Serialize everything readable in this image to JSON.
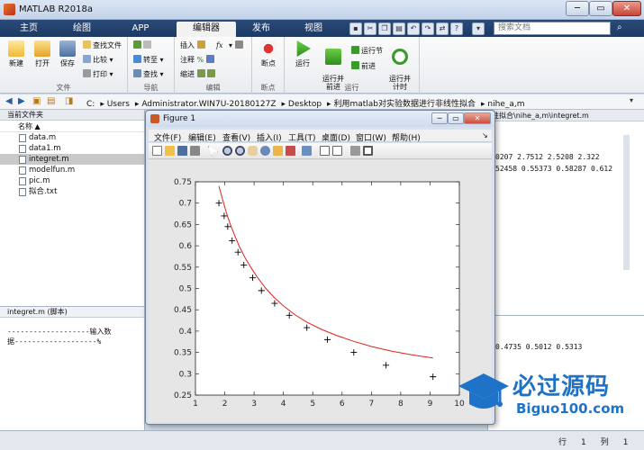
{
  "window": {
    "title": "MATLAB R2018a",
    "min": "─",
    "max": "▭",
    "close": "✕"
  },
  "ribbon_tabs": [
    "主页",
    "绘图",
    "APP",
    "编辑器",
    "发布",
    "视图"
  ],
  "search": {
    "placeholder": "搜索文档"
  },
  "ribbon": {
    "file": {
      "label": "文件",
      "new": "新建",
      "open": "打开",
      "save": "保存",
      "find_files": "查找文件",
      "compare": "比较",
      "print": "打印"
    },
    "navigate": {
      "label": "导航",
      "goto": "转至",
      "find": "查找"
    },
    "edit": {
      "label": "编辑",
      "insert": "插入",
      "comment": "注释",
      "indent": "缩进",
      "fx": "fx"
    },
    "breakpoints": {
      "label": "断点",
      "breakpoints": "断点"
    },
    "run": {
      "label": "运行",
      "run": "运行",
      "run_advance": "运行并\n前进",
      "run_section": "运行节",
      "advance": "前进",
      "run_time": "运行并\n计时"
    }
  },
  "address": {
    "segments": [
      "C:",
      "Users",
      "Administrator.WIN7U-20180127Z",
      "Desktop",
      "利用matlab对实验数据进行非线性拟合",
      "nihe_a,m"
    ]
  },
  "file_panel": {
    "header": "当前文件夹",
    "column": "名称 ▲",
    "files": [
      "data.m",
      "data1.m",
      "integret.m",
      "modelfun.m",
      "pic.m",
      "拟合.txt"
    ]
  },
  "detail_panel": {
    "header": "integret.m  (脚本)",
    "lines": [
      "-------------------输入数",
      "据-------------------%"
    ]
  },
  "editor": {
    "header": "性拟合\\nihe_a,m\\integret.m",
    "row1": "0207  2.7512  2.5208  2.322",
    "row2": "52458 0.55373 0.58287 0.612"
  },
  "command": {
    "row1": "0.4735    0.5012    0.5313"
  },
  "status": {
    "row_label": "行",
    "row_value": "1",
    "col_label": "列",
    "col_value": "1"
  },
  "figure": {
    "title": "Figure 1",
    "menus": [
      "文件(F)",
      "编辑(E)",
      "查看(V)",
      "插入(I)",
      "工具(T)",
      "桌面(D)",
      "窗口(W)",
      "帮助(H)"
    ]
  },
  "chart_data": {
    "type": "scatter",
    "title": "",
    "xlabel": "",
    "ylabel": "",
    "xlim": [
      1,
      10
    ],
    "ylim": [
      0.25,
      0.75
    ],
    "xticks": [
      1,
      2,
      3,
      4,
      5,
      6,
      7,
      8,
      9,
      10
    ],
    "yticks": [
      0.25,
      0.3,
      0.35,
      0.4,
      0.45,
      0.5,
      0.55,
      0.6,
      0.65,
      0.7,
      0.75
    ],
    "grid": false,
    "series": [
      {
        "marker": "+",
        "color": "#000000",
        "x": [
          1.8,
          1.98,
          2.1,
          2.25,
          2.45,
          2.65,
          2.95,
          3.25,
          3.7,
          4.2,
          4.8,
          5.5,
          6.4,
          7.5,
          9.1
        ],
        "y": [
          0.7,
          0.67,
          0.645,
          0.612,
          0.585,
          0.555,
          0.525,
          0.495,
          0.465,
          0.437,
          0.408,
          0.38,
          0.35,
          0.32,
          0.293
        ]
      },
      {
        "line": true,
        "color": "#e02020",
        "x": [
          1.8,
          1.9,
          2.0,
          2.1,
          2.2,
          2.35,
          2.5,
          2.7,
          2.9,
          3.1,
          3.4,
          3.7,
          4.0,
          4.4,
          4.8,
          5.3,
          5.8,
          6.4,
          7.0,
          7.7,
          8.4,
          9.1
        ],
        "y": [
          0.74,
          0.715,
          0.69,
          0.668,
          0.648,
          0.622,
          0.598,
          0.571,
          0.548,
          0.527,
          0.5,
          0.478,
          0.459,
          0.438,
          0.421,
          0.404,
          0.39,
          0.376,
          0.364,
          0.353,
          0.344,
          0.337
        ]
      }
    ]
  },
  "watermark": {
    "title": "必过源码",
    "url": "Biguo100.com"
  }
}
